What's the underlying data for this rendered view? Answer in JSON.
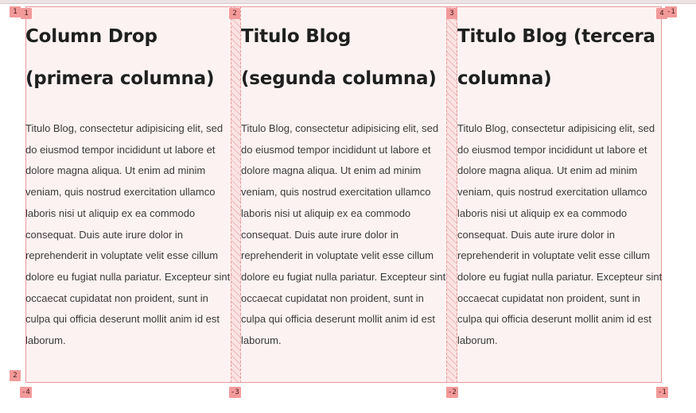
{
  "columns": [
    {
      "title": "Column Drop (primera columna)",
      "body": "Titulo Blog, consectetur adipisicing elit, sed do eiusmod tempor incididunt ut labore et dolore magna aliqua. Ut enim ad minim veniam, quis nostrud exercitation ullamco laboris nisi ut aliquip ex ea commodo consequat. Duis aute irure dolor in reprehenderit in voluptate velit esse cillum dolore eu fugiat nulla pariatur. Excepteur sint occaecat cupidatat non proident, sunt in culpa qui officia deserunt mollit anim id est laborum."
    },
    {
      "title": "Titulo Blog (segunda columna)",
      "body": "Titulo Blog, consectetur adipisicing elit, sed do eiusmod tempor incididunt ut labore et dolore magna aliqua. Ut enim ad minim veniam, quis nostrud exercitation ullamco laboris nisi ut aliquip ex ea commodo consequat. Duis aute irure dolor in reprehenderit in voluptate velit esse cillum dolore eu fugiat nulla pariatur. Excepteur sint occaecat cupidatat non proident, sunt in culpa qui officia deserunt mollit anim id est laborum."
    },
    {
      "title": "Titulo Blog (tercera columna)",
      "body": "Titulo Blog, consectetur adipisicing elit, sed do eiusmod tempor incididunt ut labore et dolore magna aliqua. Ut enim ad minim veniam, quis nostrud exercitation ullamco laboris nisi ut aliquip ex ea commodo consequat. Duis aute irure dolor in reprehenderit in voluptate velit esse cillum dolore eu fugiat nulla pariatur. Excepteur sint occaecat cupidatat non proident, sunt in culpa qui officia deserunt mollit anim id est laborum."
    }
  ],
  "grid_overlay": {
    "accent_color": "#e79a9a",
    "badge_color": "#f29a9a",
    "column_line_top": [
      "1",
      "2",
      "3",
      "4"
    ],
    "column_line_top_negative": "-1",
    "row_line_start": [
      "1",
      "2"
    ],
    "column_line_bottom": [
      "-4",
      "-3",
      "-2",
      "-1"
    ]
  }
}
